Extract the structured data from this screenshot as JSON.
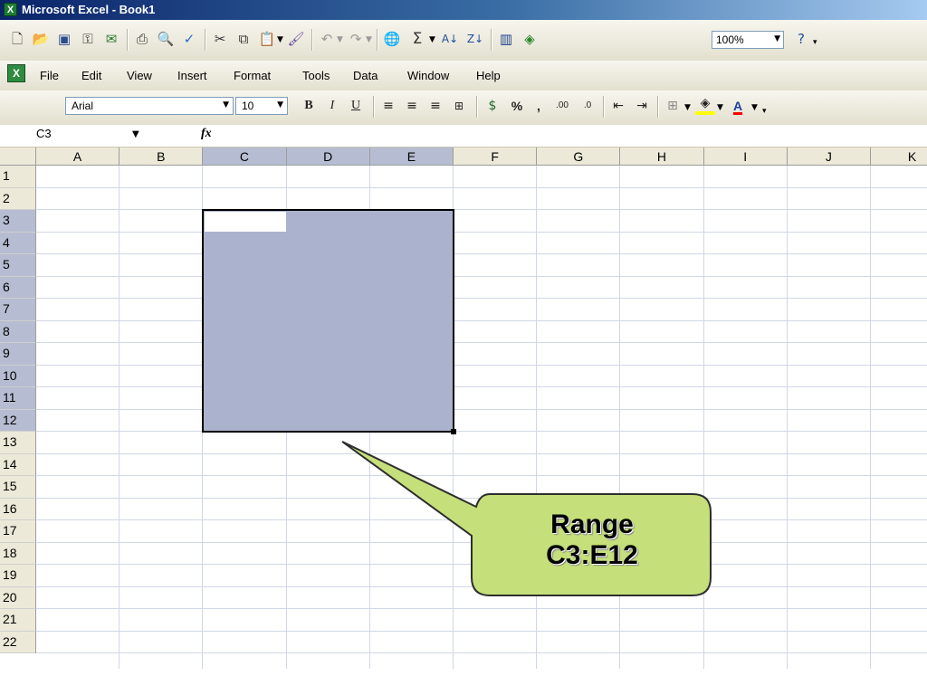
{
  "window": {
    "title": "Microsoft Excel - Book1"
  },
  "toolbar": {
    "icons": [
      "new-icon",
      "open-icon",
      "save-icon",
      "permission-icon",
      "email-icon",
      "print-icon",
      "print-preview-icon",
      "spelling-icon",
      "cut-icon",
      "copy-icon",
      "paste-icon",
      "format-painter-icon",
      "undo-icon",
      "redo-icon",
      "hyperlink-icon",
      "autosum-icon",
      "sort-ascending-icon",
      "sort-descending-icon",
      "chart-wizard-icon",
      "drawing-icon",
      "help-icon"
    ],
    "autosum_label": "Σ",
    "zoom": "100%"
  },
  "menu": [
    "File",
    "Edit",
    "View",
    "Insert",
    "Format",
    "Tools",
    "Data",
    "Window",
    "Help"
  ],
  "format_toolbar": {
    "font": "Arial",
    "size": "10",
    "bold": "B",
    "italic": "I",
    "underline": "U",
    "percent": "%",
    "comma": ","
  },
  "formula_bar": {
    "name_box": "C3",
    "fx_label": "fx",
    "formula": ""
  },
  "sheet": {
    "columns": [
      "A",
      "B",
      "C",
      "D",
      "E",
      "F",
      "G",
      "H",
      "I",
      "J",
      "K"
    ],
    "rows": [
      "1",
      "2",
      "3",
      "4",
      "5",
      "6",
      "7",
      "8",
      "9",
      "10",
      "11",
      "12",
      "13",
      "14",
      "15",
      "16",
      "17",
      "18",
      "19",
      "20",
      "21",
      "22"
    ],
    "selected_columns": [
      "C",
      "D",
      "E"
    ],
    "selected_rows": [
      "3",
      "4",
      "5",
      "6",
      "7",
      "8",
      "9",
      "10",
      "11",
      "12"
    ],
    "active_cell": "C3",
    "selection": "C3:E12"
  },
  "callout": {
    "line1": "Range",
    "line2": "C3:E12",
    "fill": "#c5e07a",
    "border": "#2e2e2e"
  },
  "colors": {
    "selection_fill": "#aab2cd",
    "header_selected": "#b6bdd2",
    "header": "#ece9d8",
    "gridline": "#d0d7e5"
  }
}
